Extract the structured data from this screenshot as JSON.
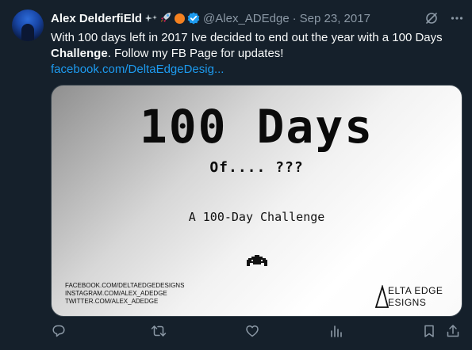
{
  "author": {
    "name": "Alex DelderfiEld",
    "handle": "@Alex_ADEdge",
    "separator": "·",
    "date": "Sep 23, 2017",
    "badge_color": "#1d9bf0"
  },
  "tweet": {
    "text_part1": "With 100 days left in 2017 Ive decided to end out the year with a 100 Days ",
    "text_bold": "Challenge",
    "text_part2": ". Follow my FB Page for updates!",
    "link": "facebook.com/DeltaEdgeDesig..."
  },
  "card": {
    "title": "100 Days",
    "subtitle": "Of.... ???",
    "challenge": "A 100-Day Challenge",
    "social": [
      "FACEBOOK.COM/DELTAEDGEDESIGNS",
      "INSTAGRAM.COM/ALEX_ADEDGE",
      "TWITTER.COM/ALEX_ADEDGE"
    ],
    "brand_line1": "ELTA EDGE",
    "brand_line2": "ESIGNS"
  },
  "icons": {
    "reply": "reply-icon",
    "retweet": "retweet-icon",
    "like": "like-icon",
    "views": "views-icon",
    "bookmark": "bookmark-icon",
    "share": "share-icon",
    "grok": "grok-icon",
    "more": "more-icon"
  },
  "colors": {
    "background": "#15202b",
    "text": "#f7f9f9",
    "muted": "#8b98a5",
    "link": "#1d9bf0"
  }
}
